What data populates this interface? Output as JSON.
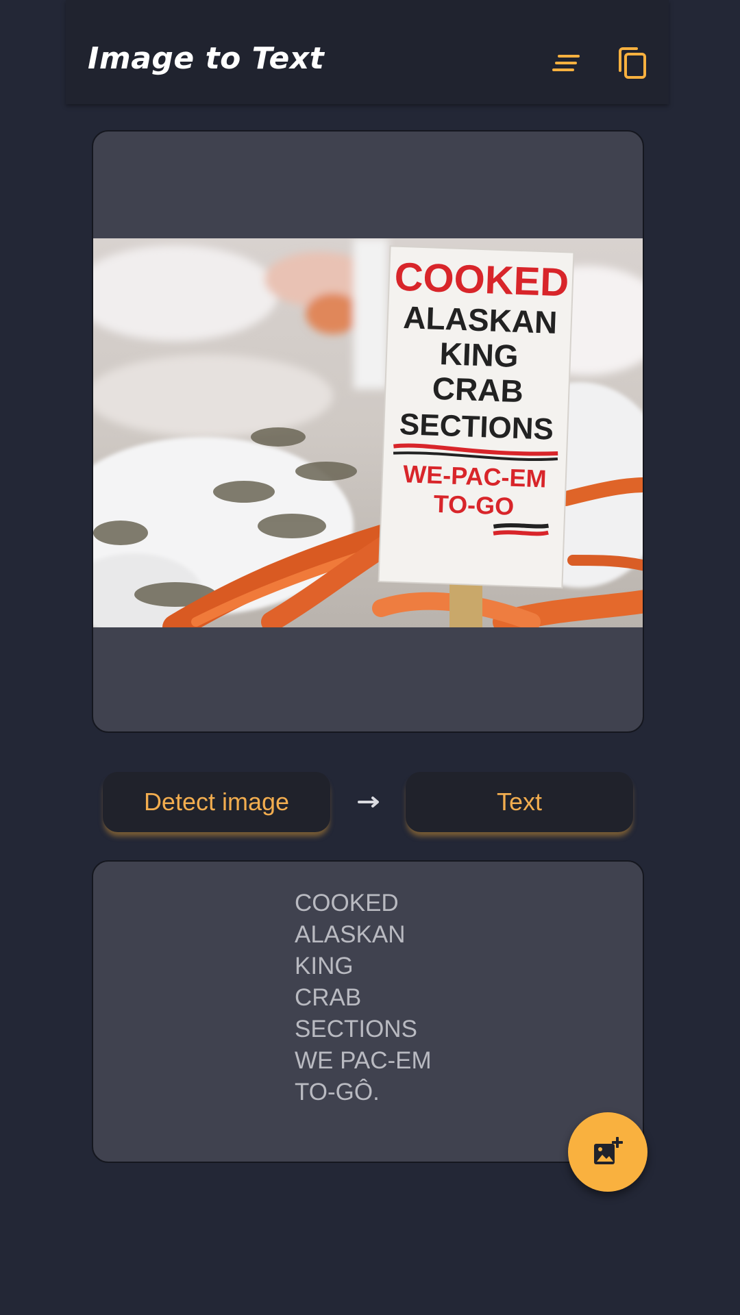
{
  "app": {
    "title": "Image to Text"
  },
  "header": {
    "menu_icon": "sort-lines-icon",
    "copy_icon": "copy-icon"
  },
  "image_card": {
    "photo_description_alt": "cooked alaskan king crab sign photo"
  },
  "actions": {
    "detect_label": "Detect image",
    "arrow_icon": "arrow-right-icon",
    "text_label": "Text"
  },
  "result": {
    "lines": [
      "COOKED",
      "ALASKAN",
      "KING",
      "CRAB",
      "SECTIONS",
      "WE PAC-EM",
      "TO-GÔ."
    ]
  },
  "fab": {
    "icon": "add-photo-icon"
  },
  "colors": {
    "background": "#232736",
    "card": "#40424f",
    "accent": "#f9b13f",
    "button_text": "#f2ad4f",
    "result_text": "#b9bac1"
  }
}
